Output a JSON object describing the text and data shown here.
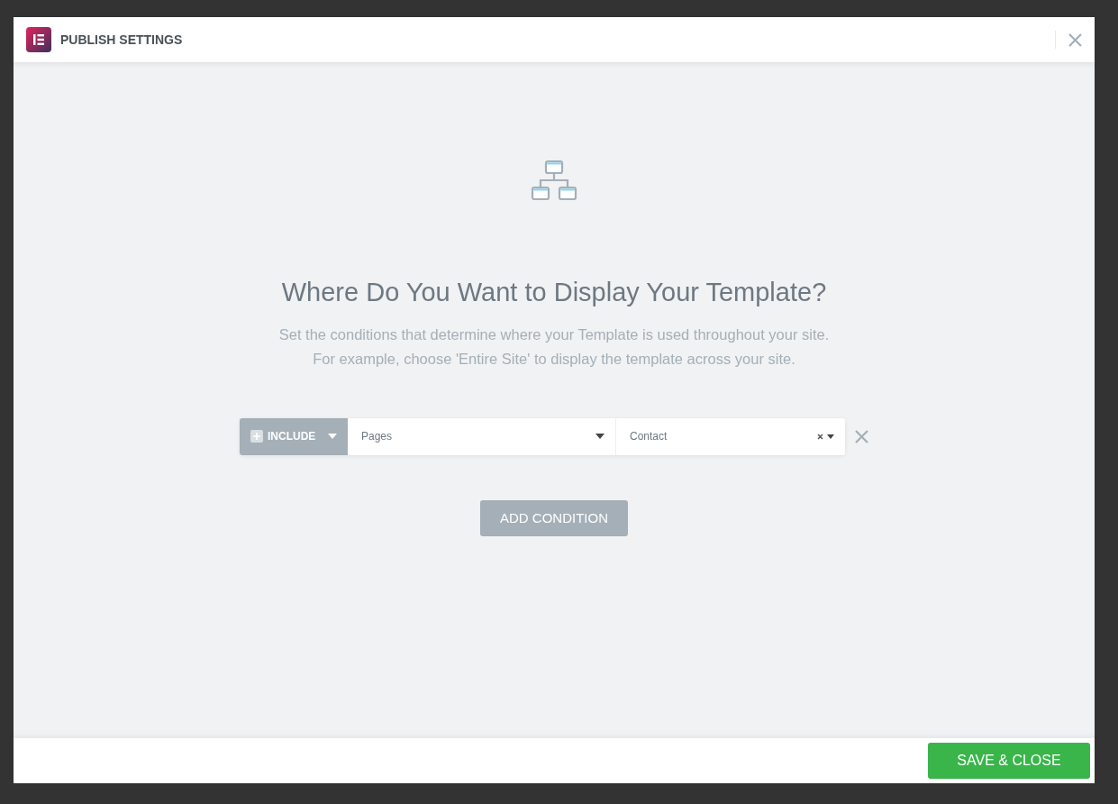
{
  "modal": {
    "title": "PUBLISH SETTINGS"
  },
  "content": {
    "heading": "Where Do You Want to Display Your Template?",
    "description": [
      "Set the conditions that determine where your Template is used throughout your site.",
      "For example, choose 'Entire Site' to display the template across your site."
    ]
  },
  "conditions": [
    {
      "type_label": "INCLUDE",
      "name": "Pages",
      "sub_name": "Contact",
      "clearable": true
    }
  ],
  "add_condition": "ADD CONDITION",
  "footer": {
    "save_button": "SAVE & CLOSE"
  }
}
